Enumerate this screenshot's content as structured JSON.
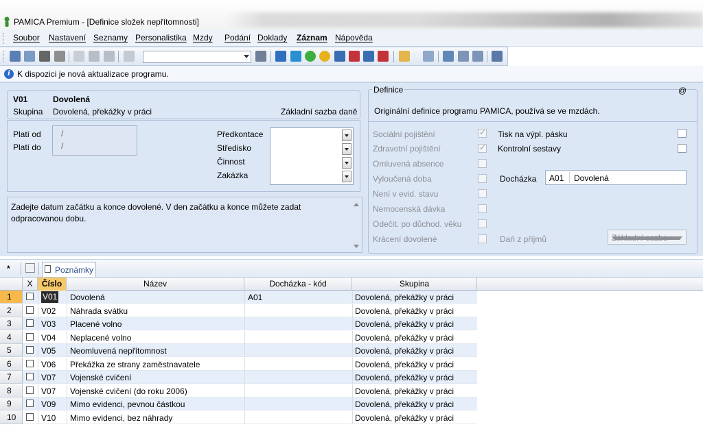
{
  "window": {
    "title": "PAMICA Premium - [Definice složek nepřítomnosti]"
  },
  "menu": {
    "items": [
      "Soubor",
      "Nastavení",
      "Seznamy",
      "Personalistika",
      "Mzdy",
      "Podání",
      "Doklady",
      "Záznam",
      "Nápověda"
    ]
  },
  "toolbar": {
    "combo_value": ""
  },
  "info": {
    "text": "K dispozici je nová aktualizace programu."
  },
  "detail": {
    "code": "V01",
    "name": "Dovolená",
    "group_label": "Skupina",
    "group_value": "Dovolená, překážky v práci",
    "base_label": "Základní sazba daně",
    "valid_from_label": "Platí od",
    "valid_to_label": "Platí do",
    "valid_from_value": "/",
    "valid_to_value": "/",
    "predkontace_label": "Předkontace",
    "stredisko_label": "Středisko",
    "cinnost_label": "Činnost",
    "zakazka_label": "Zakázka",
    "note": "Zadejte datum začátku a konce dovolené. V den začátku a konce můžete zadat odpracovanou dobu."
  },
  "definice": {
    "title": "Definice",
    "at_sign": "@",
    "description": "Originální definice programu PAMICA, používá se ve mzdách.",
    "flags": [
      {
        "label": "Sociální pojištění",
        "checked": true
      },
      {
        "label": "Zdravotní pojištění",
        "checked": true
      },
      {
        "label": "Omluvená absence",
        "checked": false
      },
      {
        "label": "Vyloučená doba",
        "checked": false
      },
      {
        "label": "Není v evid. stavu",
        "checked": false
      },
      {
        "label": "Nemocenská dávka",
        "checked": false
      },
      {
        "label": "Odečit. po důchod. věku",
        "checked": false
      },
      {
        "label": "Krácení dovolené",
        "checked": false
      }
    ],
    "print_label": "Tisk na výpl. pásku",
    "control_label": "Kontrolní sestavy",
    "attendance_label": "Docházka",
    "attendance_code": "A01",
    "attendance_name": "Dovolená",
    "tax_label": "Daň z příjmů",
    "tax_value": "Základní sazba"
  },
  "tabs": {
    "star": "*",
    "notes": "Poznámky"
  },
  "grid": {
    "headers": {
      "x": "X",
      "cislo": "Číslo",
      "nazev": "Název",
      "dochazka": "Docházka - kód",
      "skupina": "Skupina"
    },
    "rows": [
      {
        "n": "1",
        "cislo": "V01",
        "nazev": "Dovolená",
        "dochazka": "A01",
        "skupina": "Dovolená, překážky v práci"
      },
      {
        "n": "2",
        "cislo": "V02",
        "nazev": "Náhrada svátku",
        "dochazka": "",
        "skupina": "Dovolená, překážky v práci"
      },
      {
        "n": "3",
        "cislo": "V03",
        "nazev": "Placené volno",
        "dochazka": "",
        "skupina": "Dovolená, překážky v práci"
      },
      {
        "n": "4",
        "cislo": "V04",
        "nazev": "Neplacené volno",
        "dochazka": "",
        "skupina": "Dovolená, překážky v práci"
      },
      {
        "n": "5",
        "cislo": "V05",
        "nazev": "Neomluvená nepřítomnost",
        "dochazka": "",
        "skupina": "Dovolená, překážky v práci"
      },
      {
        "n": "6",
        "cislo": "V06",
        "nazev": "Překážka ze strany zaměstnavatele",
        "dochazka": "",
        "skupina": "Dovolená, překážky v práci"
      },
      {
        "n": "7",
        "cislo": "V07",
        "nazev": "Vojenské cvičení",
        "dochazka": "",
        "skupina": "Dovolená, překážky v práci"
      },
      {
        "n": "8",
        "cislo": "V07",
        "nazev": "Vojenské cvičení (do roku 2006)",
        "dochazka": "",
        "skupina": "Dovolená, překážky v práci"
      },
      {
        "n": "9",
        "cislo": "V09",
        "nazev": "Mimo evidenci, pevnou částkou",
        "dochazka": "",
        "skupina": "Dovolená, překážky v práci"
      },
      {
        "n": "10",
        "cislo": "V10",
        "nazev": "Mimo evidenci, bez náhrady",
        "dochazka": "",
        "skupina": "Dovolená, překážky v práci"
      }
    ]
  }
}
